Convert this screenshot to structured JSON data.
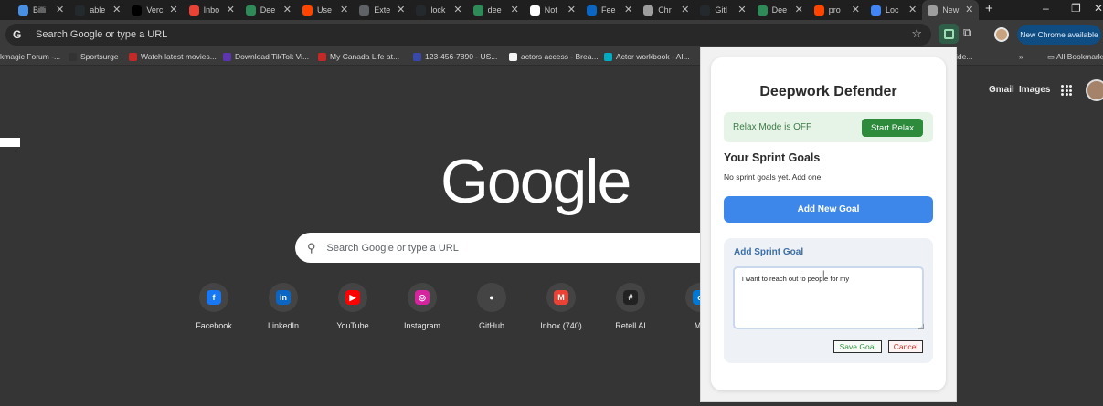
{
  "tabs": [
    {
      "label": "Billi",
      "icon": "chrome-logo-icon",
      "color": "#4a90e2"
    },
    {
      "label": "able",
      "icon": "github-icon",
      "color": "#24292e"
    },
    {
      "label": "Verc",
      "icon": "vercel-icon",
      "color": "#000000"
    },
    {
      "label": "Inbo",
      "icon": "gmail-icon",
      "color": "#ea4335"
    },
    {
      "label": "Dee",
      "icon": "extension-green-icon",
      "color": "#2e8b57"
    },
    {
      "label": "Use",
      "icon": "reddit-icon",
      "color": "#ff4500"
    },
    {
      "label": "Exte",
      "icon": "puzzle-icon",
      "color": "#5f6368"
    },
    {
      "label": "lock",
      "icon": "github-icon",
      "color": "#24292e"
    },
    {
      "label": "dee",
      "icon": "arrow-green-icon",
      "color": "#2e8b57"
    },
    {
      "label": "Not",
      "icon": "notion-icon",
      "color": "#ffffff"
    },
    {
      "label": "Fee",
      "icon": "linkedin-icon",
      "color": "#0a66c2"
    },
    {
      "label": "Chr",
      "icon": "chrome-logo-icon",
      "color": "#9e9e9e"
    },
    {
      "label": "Gitl",
      "icon": "github-icon",
      "color": "#24292e"
    },
    {
      "label": "Dee",
      "icon": "extension-green-icon",
      "color": "#2e8b57"
    },
    {
      "label": "pro",
      "icon": "reddit-icon",
      "color": "#ff4500"
    },
    {
      "label": "Loc",
      "icon": "docs-icon",
      "color": "#4285f4"
    },
    {
      "label": "New",
      "icon": "chrome-logo-icon",
      "color": "#9e9e9e"
    }
  ],
  "omnibox": {
    "placeholder": "Search Google or type a URL"
  },
  "toolbar": {
    "new_chrome_label": "New Chrome available"
  },
  "bookmarks": [
    {
      "label": "kmagic Forum -...",
      "color": "#777777"
    },
    {
      "label": "Sportsurge",
      "color": "#333333"
    },
    {
      "label": "Watch latest movies...",
      "color": "#c62828"
    },
    {
      "label": "Download TikTok Vi...",
      "color": "#5e35b1"
    },
    {
      "label": "My Canada Life at...",
      "color": "#c62828"
    },
    {
      "label": "123-456-7890 - US...",
      "color": "#3949ab"
    },
    {
      "label": "actors access - Brea...",
      "color": "#f5f5f5"
    },
    {
      "label": "Actor workbook - AI...",
      "color": "#00acc1"
    }
  ],
  "bookmarks_overflow": "ide...",
  "all_bookmarks_label": "All Bookmarks",
  "ntp": {
    "gmail_label": "Gmail",
    "images_label": "Images",
    "logo_text": "Google",
    "search_placeholder": "Search Google or type a URL",
    "shortcuts": [
      {
        "label": "Facebook",
        "icon": "facebook-icon",
        "color": "#1877f2",
        "glyph": "f"
      },
      {
        "label": "LinkedIn",
        "icon": "linkedin-icon",
        "color": "#0a66c2",
        "glyph": "in"
      },
      {
        "label": "YouTube",
        "icon": "youtube-icon",
        "color": "#ff0000",
        "glyph": "▶"
      },
      {
        "label": "Instagram",
        "icon": "instagram-icon",
        "color": "#d6249f",
        "glyph": "◎"
      },
      {
        "label": "GitHub",
        "icon": "github-icon",
        "color": "#444444",
        "glyph": "●"
      },
      {
        "label": "Inbox (740)",
        "icon": "gmail-icon",
        "color": "#ea4335",
        "glyph": "M"
      },
      {
        "label": "Retell AI",
        "icon": "retell-icon",
        "color": "#222222",
        "glyph": "#"
      },
      {
        "label": "Ma",
        "icon": "outlook-icon",
        "color": "#0078d4",
        "glyph": "o"
      }
    ]
  },
  "popup": {
    "title": "Deepwork Defender",
    "relax_status": "Relax Mode is OFF",
    "relax_button": "Start Relax",
    "goals_heading": "Your Sprint Goals",
    "goals_empty": "No sprint goals yet. Add one!",
    "add_goal_button": "Add New Goal",
    "form_heading": "Add Sprint Goal",
    "goal_input_value": "i want to reach out to people for my",
    "save_button": "Save Goal",
    "cancel_button": "Cancel"
  }
}
